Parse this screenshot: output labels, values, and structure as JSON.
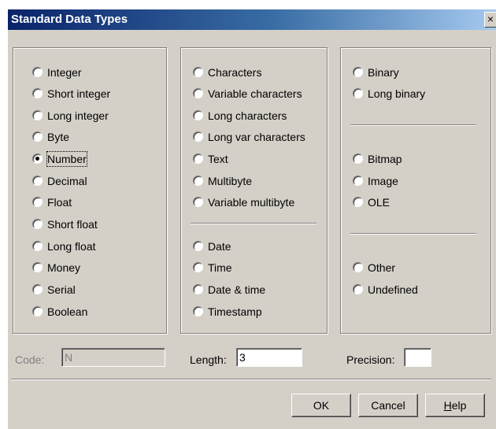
{
  "window": {
    "title": "Standard Data Types",
    "close_glyph": "×"
  },
  "groups": {
    "numeric": [
      "Integer",
      "Short integer",
      "Long integer",
      "Byte",
      "Number",
      "Decimal",
      "Float",
      "Short float",
      "Long float",
      "Money",
      "Serial",
      "Boolean"
    ],
    "character": [
      "Characters",
      "Variable characters",
      "Long characters",
      "Long var characters",
      "Text",
      "Multibyte",
      "Variable multibyte"
    ],
    "datetime": [
      "Date",
      "Time",
      "Date & time",
      "Timestamp"
    ],
    "binary": [
      "Binary",
      "Long binary"
    ],
    "image": [
      "Bitmap",
      "Image",
      "OLE"
    ],
    "other": [
      "Other",
      "Undefined"
    ]
  },
  "selected": "Number",
  "fields": {
    "code_label": "Code:",
    "code_value": "N",
    "length_label": "Length:",
    "length_value": "3",
    "precision_label": "Precision:",
    "precision_value": ""
  },
  "buttons": {
    "ok": "OK",
    "cancel": "Cancel",
    "help_first": "H",
    "help_rest": "elp"
  }
}
